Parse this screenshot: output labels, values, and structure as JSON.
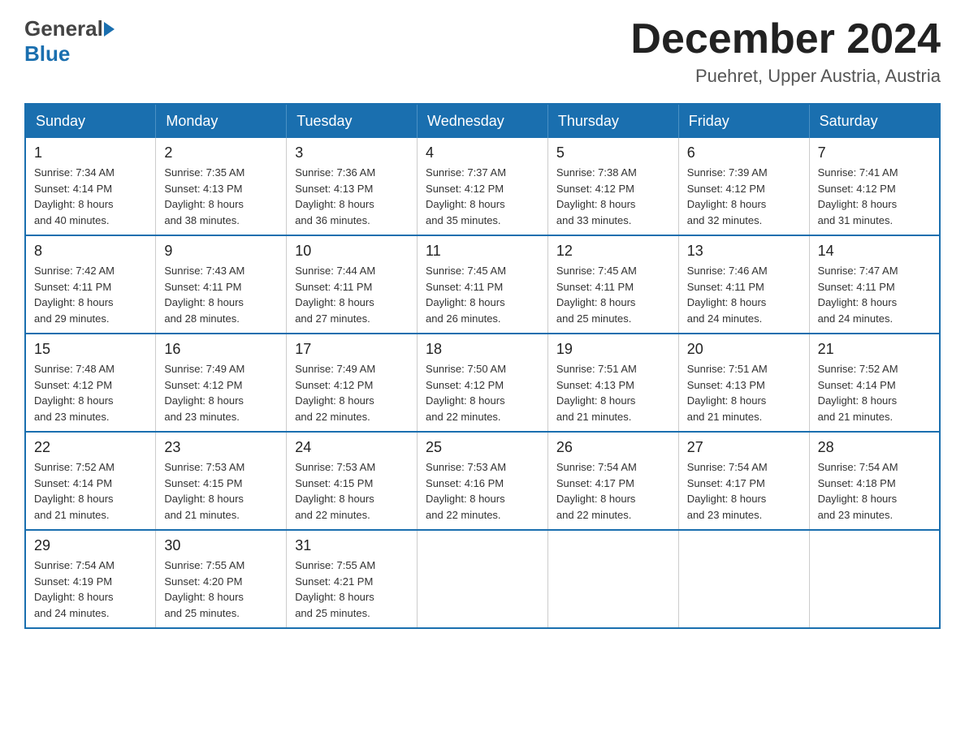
{
  "header": {
    "logo_general": "General",
    "logo_blue": "Blue",
    "month_title": "December 2024",
    "location": "Puehret, Upper Austria, Austria"
  },
  "weekdays": [
    "Sunday",
    "Monday",
    "Tuesday",
    "Wednesday",
    "Thursday",
    "Friday",
    "Saturday"
  ],
  "weeks": [
    [
      {
        "day": "1",
        "sunrise": "7:34 AM",
        "sunset": "4:14 PM",
        "daylight": "8 hours and 40 minutes."
      },
      {
        "day": "2",
        "sunrise": "7:35 AM",
        "sunset": "4:13 PM",
        "daylight": "8 hours and 38 minutes."
      },
      {
        "day": "3",
        "sunrise": "7:36 AM",
        "sunset": "4:13 PM",
        "daylight": "8 hours and 36 minutes."
      },
      {
        "day": "4",
        "sunrise": "7:37 AM",
        "sunset": "4:12 PM",
        "daylight": "8 hours and 35 minutes."
      },
      {
        "day": "5",
        "sunrise": "7:38 AM",
        "sunset": "4:12 PM",
        "daylight": "8 hours and 33 minutes."
      },
      {
        "day": "6",
        "sunrise": "7:39 AM",
        "sunset": "4:12 PM",
        "daylight": "8 hours and 32 minutes."
      },
      {
        "day": "7",
        "sunrise": "7:41 AM",
        "sunset": "4:12 PM",
        "daylight": "8 hours and 31 minutes."
      }
    ],
    [
      {
        "day": "8",
        "sunrise": "7:42 AM",
        "sunset": "4:11 PM",
        "daylight": "8 hours and 29 minutes."
      },
      {
        "day": "9",
        "sunrise": "7:43 AM",
        "sunset": "4:11 PM",
        "daylight": "8 hours and 28 minutes."
      },
      {
        "day": "10",
        "sunrise": "7:44 AM",
        "sunset": "4:11 PM",
        "daylight": "8 hours and 27 minutes."
      },
      {
        "day": "11",
        "sunrise": "7:45 AM",
        "sunset": "4:11 PM",
        "daylight": "8 hours and 26 minutes."
      },
      {
        "day": "12",
        "sunrise": "7:45 AM",
        "sunset": "4:11 PM",
        "daylight": "8 hours and 25 minutes."
      },
      {
        "day": "13",
        "sunrise": "7:46 AM",
        "sunset": "4:11 PM",
        "daylight": "8 hours and 24 minutes."
      },
      {
        "day": "14",
        "sunrise": "7:47 AM",
        "sunset": "4:11 PM",
        "daylight": "8 hours and 24 minutes."
      }
    ],
    [
      {
        "day": "15",
        "sunrise": "7:48 AM",
        "sunset": "4:12 PM",
        "daylight": "8 hours and 23 minutes."
      },
      {
        "day": "16",
        "sunrise": "7:49 AM",
        "sunset": "4:12 PM",
        "daylight": "8 hours and 23 minutes."
      },
      {
        "day": "17",
        "sunrise": "7:49 AM",
        "sunset": "4:12 PM",
        "daylight": "8 hours and 22 minutes."
      },
      {
        "day": "18",
        "sunrise": "7:50 AM",
        "sunset": "4:12 PM",
        "daylight": "8 hours and 22 minutes."
      },
      {
        "day": "19",
        "sunrise": "7:51 AM",
        "sunset": "4:13 PM",
        "daylight": "8 hours and 21 minutes."
      },
      {
        "day": "20",
        "sunrise": "7:51 AM",
        "sunset": "4:13 PM",
        "daylight": "8 hours and 21 minutes."
      },
      {
        "day": "21",
        "sunrise": "7:52 AM",
        "sunset": "4:14 PM",
        "daylight": "8 hours and 21 minutes."
      }
    ],
    [
      {
        "day": "22",
        "sunrise": "7:52 AM",
        "sunset": "4:14 PM",
        "daylight": "8 hours and 21 minutes."
      },
      {
        "day": "23",
        "sunrise": "7:53 AM",
        "sunset": "4:15 PM",
        "daylight": "8 hours and 21 minutes."
      },
      {
        "day": "24",
        "sunrise": "7:53 AM",
        "sunset": "4:15 PM",
        "daylight": "8 hours and 22 minutes."
      },
      {
        "day": "25",
        "sunrise": "7:53 AM",
        "sunset": "4:16 PM",
        "daylight": "8 hours and 22 minutes."
      },
      {
        "day": "26",
        "sunrise": "7:54 AM",
        "sunset": "4:17 PM",
        "daylight": "8 hours and 22 minutes."
      },
      {
        "day": "27",
        "sunrise": "7:54 AM",
        "sunset": "4:17 PM",
        "daylight": "8 hours and 23 minutes."
      },
      {
        "day": "28",
        "sunrise": "7:54 AM",
        "sunset": "4:18 PM",
        "daylight": "8 hours and 23 minutes."
      }
    ],
    [
      {
        "day": "29",
        "sunrise": "7:54 AM",
        "sunset": "4:19 PM",
        "daylight": "8 hours and 24 minutes."
      },
      {
        "day": "30",
        "sunrise": "7:55 AM",
        "sunset": "4:20 PM",
        "daylight": "8 hours and 25 minutes."
      },
      {
        "day": "31",
        "sunrise": "7:55 AM",
        "sunset": "4:21 PM",
        "daylight": "8 hours and 25 minutes."
      },
      null,
      null,
      null,
      null
    ]
  ],
  "labels": {
    "sunrise": "Sunrise:",
    "sunset": "Sunset:",
    "daylight": "Daylight:"
  }
}
